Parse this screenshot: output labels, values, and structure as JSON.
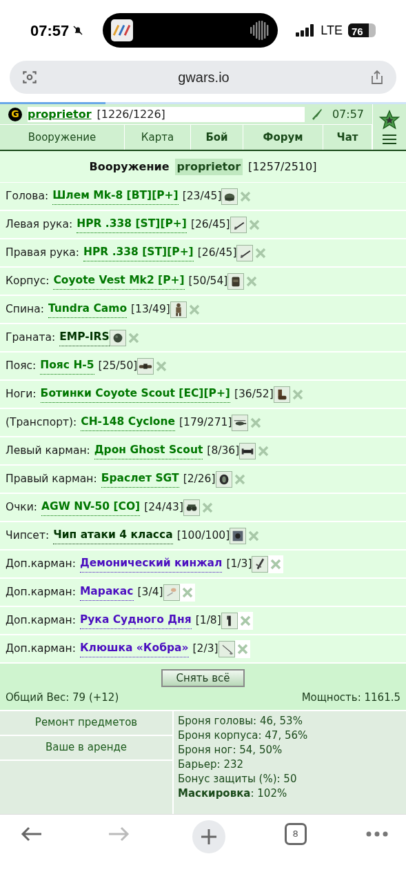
{
  "status_bar": {
    "time": "07:57",
    "network": "LTE",
    "battery": "76"
  },
  "browser": {
    "url": "gwars.io",
    "tab_count": "8"
  },
  "header": {
    "logo": "G",
    "user": "proprietor",
    "hp": "[1226/1226]",
    "time": "07:57"
  },
  "nav": [
    {
      "label": "Вооружение",
      "bold": false
    },
    {
      "label": "Карта",
      "bold": false
    },
    {
      "label": "Бой",
      "bold": true
    },
    {
      "label": "Форум",
      "bold": true
    },
    {
      "label": "Чат",
      "bold": true
    }
  ],
  "title": {
    "label": "Вооружение",
    "user": "proprietor",
    "count": "[1257/2510]"
  },
  "slots": [
    {
      "slot": "Голова:",
      "item": "Шлем Mk-8 [BT][P+]",
      "dur": "[23/45]",
      "kind": "standard"
    },
    {
      "slot": "Левая рука:",
      "item": "HPR .338 [ST][P+]",
      "dur": "[26/45]",
      "kind": "standard"
    },
    {
      "slot": "Правая рука:",
      "item": "HPR .338 [ST][P+]",
      "dur": "[26/45]",
      "kind": "standard"
    },
    {
      "slot": "Корпус:",
      "item": "Coyote Vest Mk2 [P+]",
      "dur": "[50/54]",
      "kind": "standard"
    },
    {
      "slot": "Спина:",
      "item": "Tundra Camo",
      "dur": "[13/49]",
      "kind": "standard"
    },
    {
      "slot": "Граната:",
      "item": "EMP-IRS",
      "kind": "plain"
    },
    {
      "slot": "Пояс:",
      "item": "Пояс H-5",
      "dur": "[25/50]",
      "kind": "standard"
    },
    {
      "slot": "Ноги:",
      "item": "Ботинки Coyote Scout [EC][P+]",
      "dur": "[36/52]",
      "kind": "standard"
    },
    {
      "slot": "(Транспорт):",
      "item": "CH-148 Cyclone",
      "dur": "[179/271]",
      "kind": "standard"
    },
    {
      "slot": "Левый карман:",
      "item": "Дрон Ghost Scout",
      "dur": "[8/36]",
      "kind": "standard"
    },
    {
      "slot": "Правый карман:",
      "item": "Браслет SGT",
      "dur": "[2/26]",
      "kind": "standard"
    },
    {
      "slot": "Очки:",
      "item": "AGW NV-50 [CO]",
      "dur": "[24/43]",
      "kind": "standard"
    },
    {
      "slot": "Чипсет:",
      "item": "Чип атаки 4 класса",
      "dur": "[100/100]",
      "kind": "plain"
    },
    {
      "slot": "Доп.карман:",
      "item": "Демонический кинжал",
      "dur": "[1/3]",
      "kind": "extra"
    },
    {
      "slot": "Доп.карман:",
      "item": "Маракас",
      "dur": "[3/4]",
      "kind": "extra"
    },
    {
      "slot": "Доп.карман:",
      "item": "Рука Судного Дня",
      "dur": "[1/8]",
      "kind": "extra"
    },
    {
      "slot": "Доп.карман:",
      "item": "Клюшка «Кобра»",
      "dur": "[2/3]",
      "kind": "extra"
    }
  ],
  "remove_all": "Снять всё",
  "weight": "Общий Вес: 79 (+12)",
  "power": "Мощность: 1161.5",
  "links": [
    "Ремонт предметов",
    "Ваше в аренде"
  ],
  "stats": [
    "Броня головы: 46, 53%",
    "Броня корпуса: 47, 56%",
    "Броня ног: 54, 50%",
    "Барьер: 232",
    "Бонус защиты (%): 50",
    "**Маскировка**: 102%"
  ]
}
